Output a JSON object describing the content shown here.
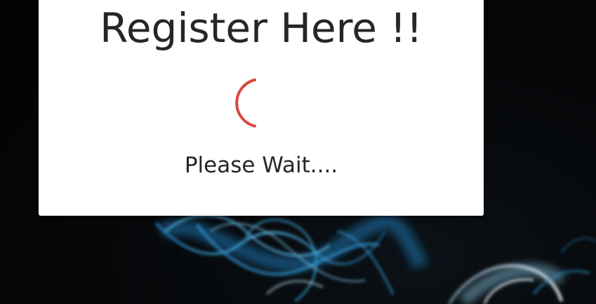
{
  "dialog": {
    "title": "Register Here !!",
    "status_text": "Please Wait...."
  },
  "loader": {
    "icon": "loading-spinner-icon",
    "color": "#d9473f"
  },
  "colors": {
    "card_background": "#ffffff",
    "text": "#262626",
    "page_background": "#050608",
    "smoke": "#3aa7d8"
  }
}
